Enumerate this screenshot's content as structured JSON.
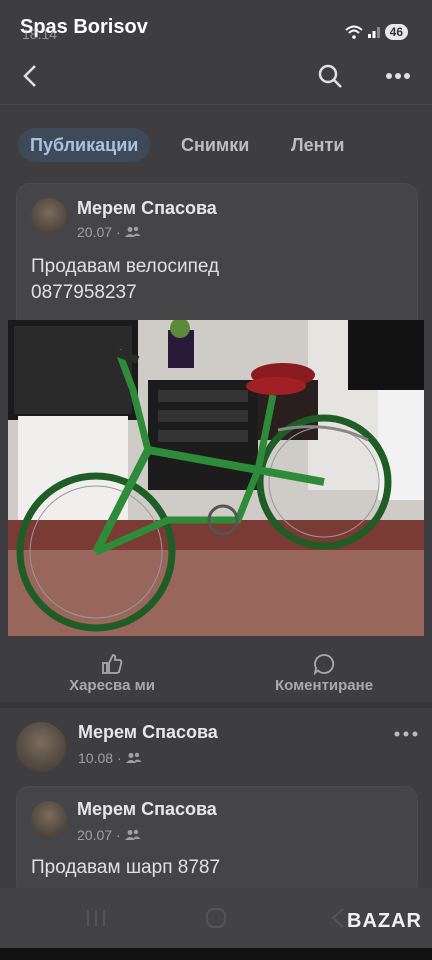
{
  "status": {
    "owner_name": "Spas Borisov",
    "time": "18:14",
    "battery": "46"
  },
  "tabs": [
    "Публикации",
    "Снимки",
    "Ленти"
  ],
  "post1": {
    "author": "Мерем Спасова",
    "date": "20.07",
    "text_line1": "Продавам велосипед",
    "text_line2": "0877958237"
  },
  "actions": {
    "like": "Харесва ми",
    "comment": "Коментиране"
  },
  "post2": {
    "author": "Мерем Спасова",
    "date": "10.08",
    "shared": {
      "author": "Мерем Спасова",
      "date": "20.07",
      "text": "Продавам шарп 8787"
    }
  },
  "watermark": "BAZAR",
  "colors": {
    "accent": "#a8c2e0",
    "background": "#3e3e40",
    "bike": "#2e8b3a"
  }
}
